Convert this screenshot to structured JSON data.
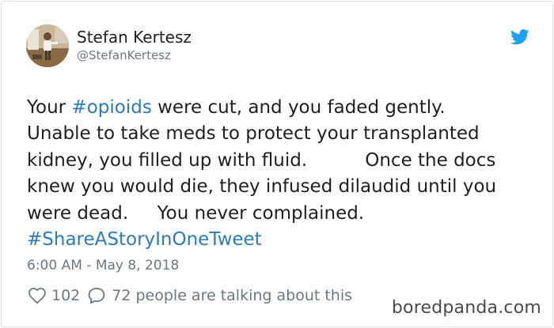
{
  "author": {
    "name": "Stefan Kertesz",
    "handle": "@StefanKertesz"
  },
  "icons": {
    "brand": "twitter-bird-icon",
    "like": "heart-icon",
    "reply": "speech-bubble-icon",
    "brand_color": "#1da1f2",
    "link_color": "#2b7bb9"
  },
  "tweet": {
    "line1_pre": "Your ",
    "line1_tag": "#opioids",
    "line1_post": " were cut, and you faded gently.",
    "line2": "Unable to take meds to protect your transplanted",
    "line3": "kidney, you filled up with fluid.          Once the docs",
    "line4": "knew you would die, they infused dilaudid until you",
    "line5": "were dead.     You never complained.",
    "line6_tag": "#ShareAStoryInOneTweet"
  },
  "timestamp": "6:00 AM - May 8, 2018",
  "stats": {
    "likes": "102",
    "talking": "72 people are talking about this"
  },
  "watermark": "boredpanda.com"
}
